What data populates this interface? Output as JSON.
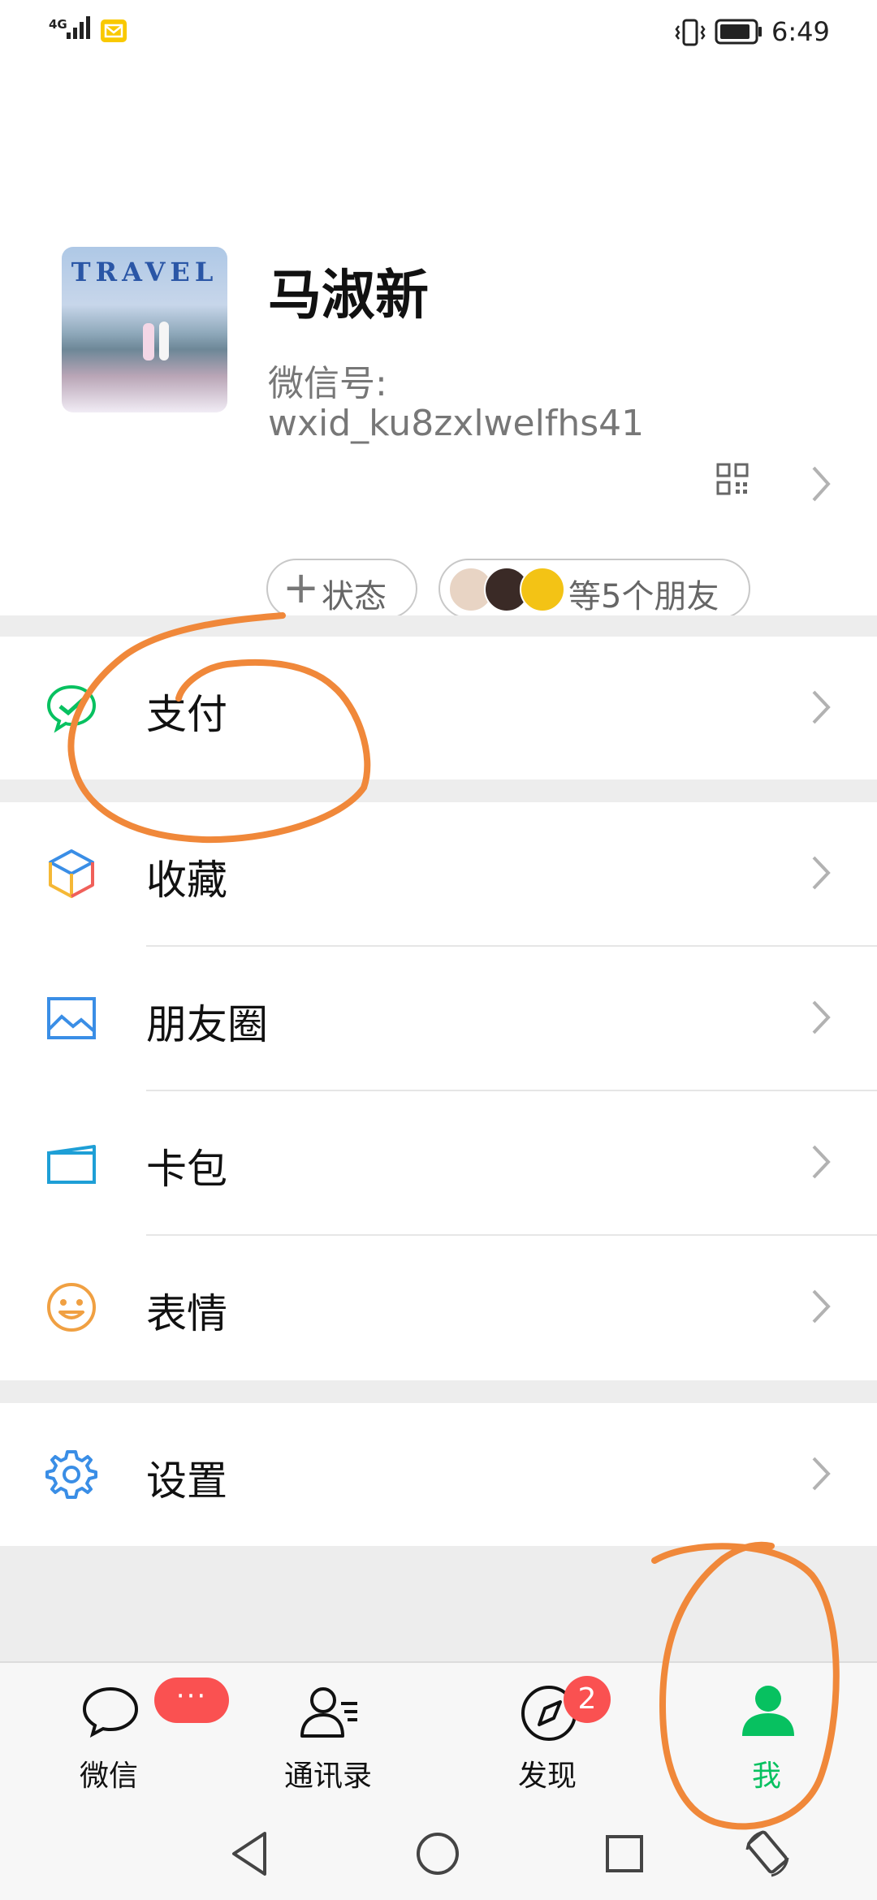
{
  "status_bar": {
    "network": "4G",
    "time": "6:49",
    "icons": [
      "signal-icon",
      "message-notification-icon",
      "vibrate-icon",
      "battery-icon"
    ]
  },
  "profile": {
    "name": "马淑新",
    "wxid_label": "微信号:",
    "wxid": "wxid_ku8zxlwelfhs41",
    "avatar_text": "TRAVEL",
    "status_button": "状态",
    "friends_text": "等5个朋友"
  },
  "menu": {
    "pay": "支付",
    "favorites": "收藏",
    "moments": "朋友圈",
    "cards": "卡包",
    "stickers": "表情",
    "settings": "设置"
  },
  "tabs": [
    {
      "label": "微信",
      "badge": "···"
    },
    {
      "label": "通讯录"
    },
    {
      "label": "发现",
      "badge": "2"
    },
    {
      "label": "我",
      "active": true
    }
  ],
  "colors": {
    "accent_green": "#07c160",
    "badge_red": "#fa5151",
    "annotation_orange": "#f0883a",
    "background_gray": "#ededed"
  }
}
